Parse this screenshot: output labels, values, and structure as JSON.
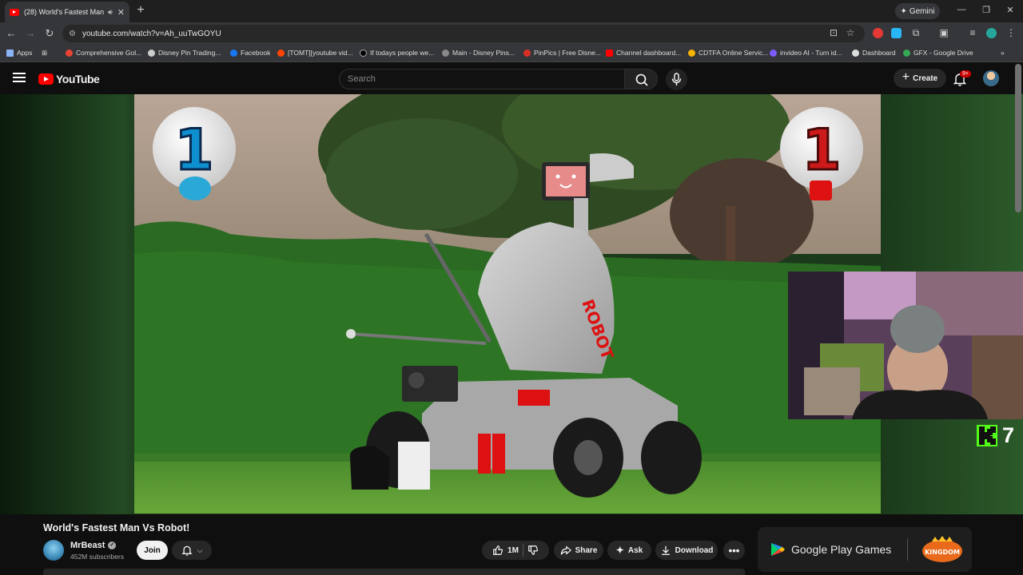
{
  "browser": {
    "tab_title": "(28) World's Fastest Man Vs",
    "new_tab": "+",
    "gemini_label": "Gemini",
    "url": "youtube.com/watch?v=Ah_uuTwGOYU",
    "bookmarks": [
      {
        "label": "Apps",
        "color": "#8ab4f8"
      },
      {
        "label": "Comprehensive Gol...",
        "color": "#e94235"
      },
      {
        "label": "Disney Pin Trading...",
        "color": "#cccccc"
      },
      {
        "label": "Facebook",
        "color": "#1877f2"
      },
      {
        "label": "[TOMT][youtube vid...",
        "color": "#ff4500"
      },
      {
        "label": "If todays people we...",
        "color": "#000000"
      },
      {
        "label": "Main - Disney Pins...",
        "color": "#888888"
      },
      {
        "label": "PinPics | Free Disne...",
        "color": "#d93025"
      },
      {
        "label": "Channel dashboard...",
        "color": "#ff0000"
      },
      {
        "label": "CDTFA Online Servic...",
        "color": "#f4b400"
      },
      {
        "label": "invideo AI - Turn id...",
        "color": "#7c5cff"
      },
      {
        "label": "Dashboard",
        "color": "#dddddd"
      },
      {
        "label": "GFX - Google Drive",
        "color": "#34a853"
      }
    ]
  },
  "youtube": {
    "logo_text": "YouTube",
    "search_placeholder": "Search",
    "create_label": "Create",
    "notification_count": "9+"
  },
  "video": {
    "title": "World's Fastest Man Vs Robot!",
    "left_score": "1",
    "right_score": "1",
    "robot_label": "ROBOT",
    "kick_number": "7"
  },
  "channel": {
    "name": "MrBeast",
    "subscribers": "452M subscribers",
    "join_label": "Join"
  },
  "actions": {
    "like_count": "1M",
    "share_label": "Share",
    "ask_label": "Ask",
    "download_label": "Download"
  },
  "ad": {
    "brand": "Google Play Games",
    "game_name": "KINGDOM"
  },
  "colors": {
    "youtube_red": "#ff0000",
    "kick_green": "#53fc18"
  }
}
